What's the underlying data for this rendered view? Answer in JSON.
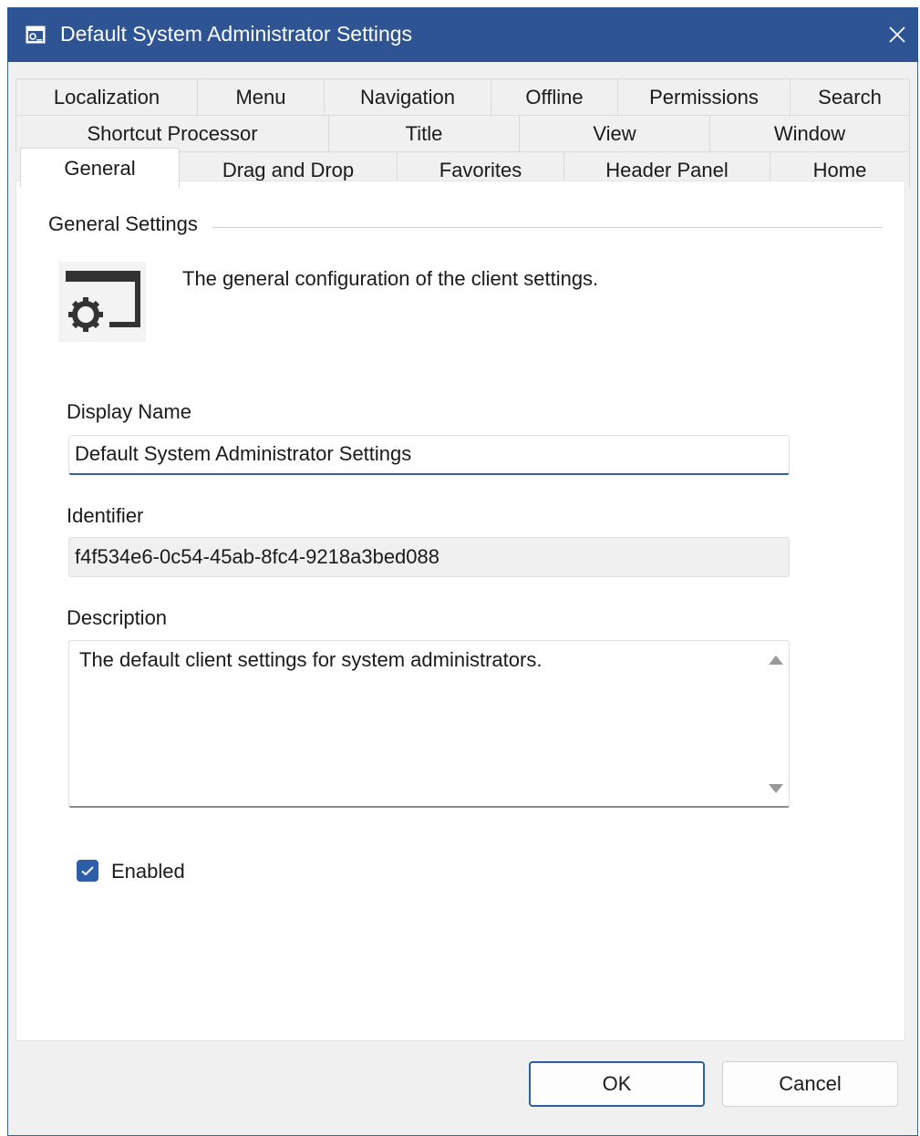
{
  "window": {
    "title": "Default System Administrator Settings",
    "accent_color": "#2e5493"
  },
  "tabs": {
    "row1": [
      "Localization",
      "Menu",
      "Navigation",
      "Offline",
      "Permissions",
      "Search"
    ],
    "row2": [
      "Shortcut Processor",
      "Title",
      "View",
      "Window"
    ],
    "row3": [
      "General",
      "Drag and Drop",
      "Favorites",
      "Header Panel",
      "Home"
    ],
    "active": "General"
  },
  "general": {
    "group_title": "General Settings",
    "description": "The general configuration of the client settings.",
    "icon": "settings-window-icon"
  },
  "fields": {
    "display_name_label": "Display Name",
    "display_name_value": "Default System Administrator Settings",
    "identifier_label": "Identifier",
    "identifier_value": "f4f534e6-0c54-45ab-8fc4-9218a3bed088",
    "description_label": "Description",
    "description_value": "The default client settings for system administrators."
  },
  "enabled": {
    "label": "Enabled",
    "checked": true
  },
  "buttons": {
    "ok": "OK",
    "cancel": "Cancel"
  }
}
